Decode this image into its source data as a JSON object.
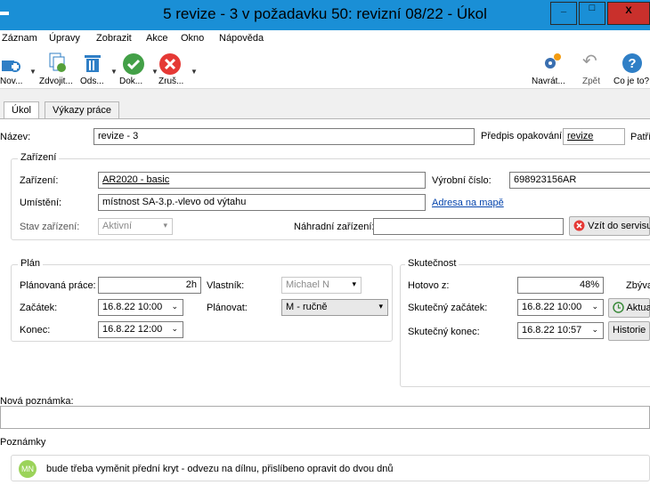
{
  "window": {
    "title": "5 revize - 3 v požadavku 50: revizní 08/22 - Úkol",
    "min": "_",
    "max": "□",
    "close": "X"
  },
  "menu": [
    "Záznam",
    "Úpravy",
    "Zobrazit",
    "Akce",
    "Okno",
    "Nápověda"
  ],
  "toolbar": {
    "new": "Nov...",
    "duplicate": "Zdvojit...",
    "send": "Ods...",
    "done": "Dok...",
    "cancel": "Zruš...",
    "return": "Navrát...",
    "undo": "Zpět",
    "whats_this": "Co je to?"
  },
  "tabs": [
    "Úkol",
    "Výkazy práce"
  ],
  "form": {
    "name_label": "Název:",
    "name_value": "revize - 3",
    "repeat_label": "Předpis opakování:",
    "repeat_value": "revize",
    "belongs_label": "Patří",
    "device_group": "Zařízení",
    "device_label": "Zařízení:",
    "device_value": "AR2020 - basic",
    "serial_label": "Výrobní číslo:",
    "serial_value": "698923156AR",
    "location_label": "Umístění:",
    "location_value": "místnost SA-3.p.-vlevo od výtahu",
    "map_link": "Adresa na mapě",
    "state_label": "Stav zařízení:",
    "state_value": "Aktivní",
    "replacement_label": "Náhradní zařízení:",
    "replacement_value": "",
    "service_button": "Vzít do servisu",
    "plan_group": "Plán",
    "planned_work_label": "Plánovaná práce:",
    "planned_work_value": "2h",
    "owner_label": "Vlastník:",
    "owner_value": "Michael N",
    "start_label": "Začátek:",
    "start_value": "16.8.22 10:00",
    "plan_label": "Plánovat:",
    "plan_value": "M - ručně",
    "end_label": "Konec:",
    "end_value": "16.8.22 12:00",
    "actual_group": "Skutečnost",
    "done_label": "Hotovo z:",
    "done_value": "48%",
    "remaining_label": "Zbýva",
    "actual_start_label": "Skutečný začátek:",
    "actual_start_value": "16.8.22 10:00",
    "refresh_button": "Aktua",
    "actual_end_label": "Skutečný konec:",
    "actual_end_value": "16.8.22 10:57",
    "history_button": "Historie",
    "new_note_label": "Nová poznámka:",
    "new_note_value": "",
    "notes_label": "Poznámky",
    "note_avatar": "MN",
    "note_text": "bude třeba vyměnit přední kryt - odvezu na dílnu, přislíbeno opravit do dvou dnů"
  }
}
